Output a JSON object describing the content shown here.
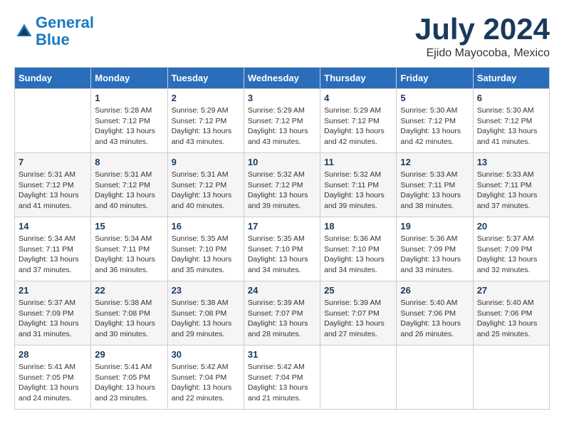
{
  "header": {
    "logo_line1": "General",
    "logo_line2": "Blue",
    "month": "July 2024",
    "location": "Ejido Mayocoba, Mexico"
  },
  "weekdays": [
    "Sunday",
    "Monday",
    "Tuesday",
    "Wednesday",
    "Thursday",
    "Friday",
    "Saturday"
  ],
  "weeks": [
    [
      {
        "day": "",
        "sunrise": "",
        "sunset": "",
        "daylight": ""
      },
      {
        "day": "1",
        "sunrise": "Sunrise: 5:28 AM",
        "sunset": "Sunset: 7:12 PM",
        "daylight": "Daylight: 13 hours and 43 minutes."
      },
      {
        "day": "2",
        "sunrise": "Sunrise: 5:29 AM",
        "sunset": "Sunset: 7:12 PM",
        "daylight": "Daylight: 13 hours and 43 minutes."
      },
      {
        "day": "3",
        "sunrise": "Sunrise: 5:29 AM",
        "sunset": "Sunset: 7:12 PM",
        "daylight": "Daylight: 13 hours and 43 minutes."
      },
      {
        "day": "4",
        "sunrise": "Sunrise: 5:29 AM",
        "sunset": "Sunset: 7:12 PM",
        "daylight": "Daylight: 13 hours and 42 minutes."
      },
      {
        "day": "5",
        "sunrise": "Sunrise: 5:30 AM",
        "sunset": "Sunset: 7:12 PM",
        "daylight": "Daylight: 13 hours and 42 minutes."
      },
      {
        "day": "6",
        "sunrise": "Sunrise: 5:30 AM",
        "sunset": "Sunset: 7:12 PM",
        "daylight": "Daylight: 13 hours and 41 minutes."
      }
    ],
    [
      {
        "day": "7",
        "sunrise": "Sunrise: 5:31 AM",
        "sunset": "Sunset: 7:12 PM",
        "daylight": "Daylight: 13 hours and 41 minutes."
      },
      {
        "day": "8",
        "sunrise": "Sunrise: 5:31 AM",
        "sunset": "Sunset: 7:12 PM",
        "daylight": "Daylight: 13 hours and 40 minutes."
      },
      {
        "day": "9",
        "sunrise": "Sunrise: 5:31 AM",
        "sunset": "Sunset: 7:12 PM",
        "daylight": "Daylight: 13 hours and 40 minutes."
      },
      {
        "day": "10",
        "sunrise": "Sunrise: 5:32 AM",
        "sunset": "Sunset: 7:12 PM",
        "daylight": "Daylight: 13 hours and 39 minutes."
      },
      {
        "day": "11",
        "sunrise": "Sunrise: 5:32 AM",
        "sunset": "Sunset: 7:11 PM",
        "daylight": "Daylight: 13 hours and 39 minutes."
      },
      {
        "day": "12",
        "sunrise": "Sunrise: 5:33 AM",
        "sunset": "Sunset: 7:11 PM",
        "daylight": "Daylight: 13 hours and 38 minutes."
      },
      {
        "day": "13",
        "sunrise": "Sunrise: 5:33 AM",
        "sunset": "Sunset: 7:11 PM",
        "daylight": "Daylight: 13 hours and 37 minutes."
      }
    ],
    [
      {
        "day": "14",
        "sunrise": "Sunrise: 5:34 AM",
        "sunset": "Sunset: 7:11 PM",
        "daylight": "Daylight: 13 hours and 37 minutes."
      },
      {
        "day": "15",
        "sunrise": "Sunrise: 5:34 AM",
        "sunset": "Sunset: 7:11 PM",
        "daylight": "Daylight: 13 hours and 36 minutes."
      },
      {
        "day": "16",
        "sunrise": "Sunrise: 5:35 AM",
        "sunset": "Sunset: 7:10 PM",
        "daylight": "Daylight: 13 hours and 35 minutes."
      },
      {
        "day": "17",
        "sunrise": "Sunrise: 5:35 AM",
        "sunset": "Sunset: 7:10 PM",
        "daylight": "Daylight: 13 hours and 34 minutes."
      },
      {
        "day": "18",
        "sunrise": "Sunrise: 5:36 AM",
        "sunset": "Sunset: 7:10 PM",
        "daylight": "Daylight: 13 hours and 34 minutes."
      },
      {
        "day": "19",
        "sunrise": "Sunrise: 5:36 AM",
        "sunset": "Sunset: 7:09 PM",
        "daylight": "Daylight: 13 hours and 33 minutes."
      },
      {
        "day": "20",
        "sunrise": "Sunrise: 5:37 AM",
        "sunset": "Sunset: 7:09 PM",
        "daylight": "Daylight: 13 hours and 32 minutes."
      }
    ],
    [
      {
        "day": "21",
        "sunrise": "Sunrise: 5:37 AM",
        "sunset": "Sunset: 7:09 PM",
        "daylight": "Daylight: 13 hours and 31 minutes."
      },
      {
        "day": "22",
        "sunrise": "Sunrise: 5:38 AM",
        "sunset": "Sunset: 7:08 PM",
        "daylight": "Daylight: 13 hours and 30 minutes."
      },
      {
        "day": "23",
        "sunrise": "Sunrise: 5:38 AM",
        "sunset": "Sunset: 7:08 PM",
        "daylight": "Daylight: 13 hours and 29 minutes."
      },
      {
        "day": "24",
        "sunrise": "Sunrise: 5:39 AM",
        "sunset": "Sunset: 7:07 PM",
        "daylight": "Daylight: 13 hours and 28 minutes."
      },
      {
        "day": "25",
        "sunrise": "Sunrise: 5:39 AM",
        "sunset": "Sunset: 7:07 PM",
        "daylight": "Daylight: 13 hours and 27 minutes."
      },
      {
        "day": "26",
        "sunrise": "Sunrise: 5:40 AM",
        "sunset": "Sunset: 7:06 PM",
        "daylight": "Daylight: 13 hours and 26 minutes."
      },
      {
        "day": "27",
        "sunrise": "Sunrise: 5:40 AM",
        "sunset": "Sunset: 7:06 PM",
        "daylight": "Daylight: 13 hours and 25 minutes."
      }
    ],
    [
      {
        "day": "28",
        "sunrise": "Sunrise: 5:41 AM",
        "sunset": "Sunset: 7:05 PM",
        "daylight": "Daylight: 13 hours and 24 minutes."
      },
      {
        "day": "29",
        "sunrise": "Sunrise: 5:41 AM",
        "sunset": "Sunset: 7:05 PM",
        "daylight": "Daylight: 13 hours and 23 minutes."
      },
      {
        "day": "30",
        "sunrise": "Sunrise: 5:42 AM",
        "sunset": "Sunset: 7:04 PM",
        "daylight": "Daylight: 13 hours and 22 minutes."
      },
      {
        "day": "31",
        "sunrise": "Sunrise: 5:42 AM",
        "sunset": "Sunset: 7:04 PM",
        "daylight": "Daylight: 13 hours and 21 minutes."
      },
      {
        "day": "",
        "sunrise": "",
        "sunset": "",
        "daylight": ""
      },
      {
        "day": "",
        "sunrise": "",
        "sunset": "",
        "daylight": ""
      },
      {
        "day": "",
        "sunrise": "",
        "sunset": "",
        "daylight": ""
      }
    ]
  ]
}
